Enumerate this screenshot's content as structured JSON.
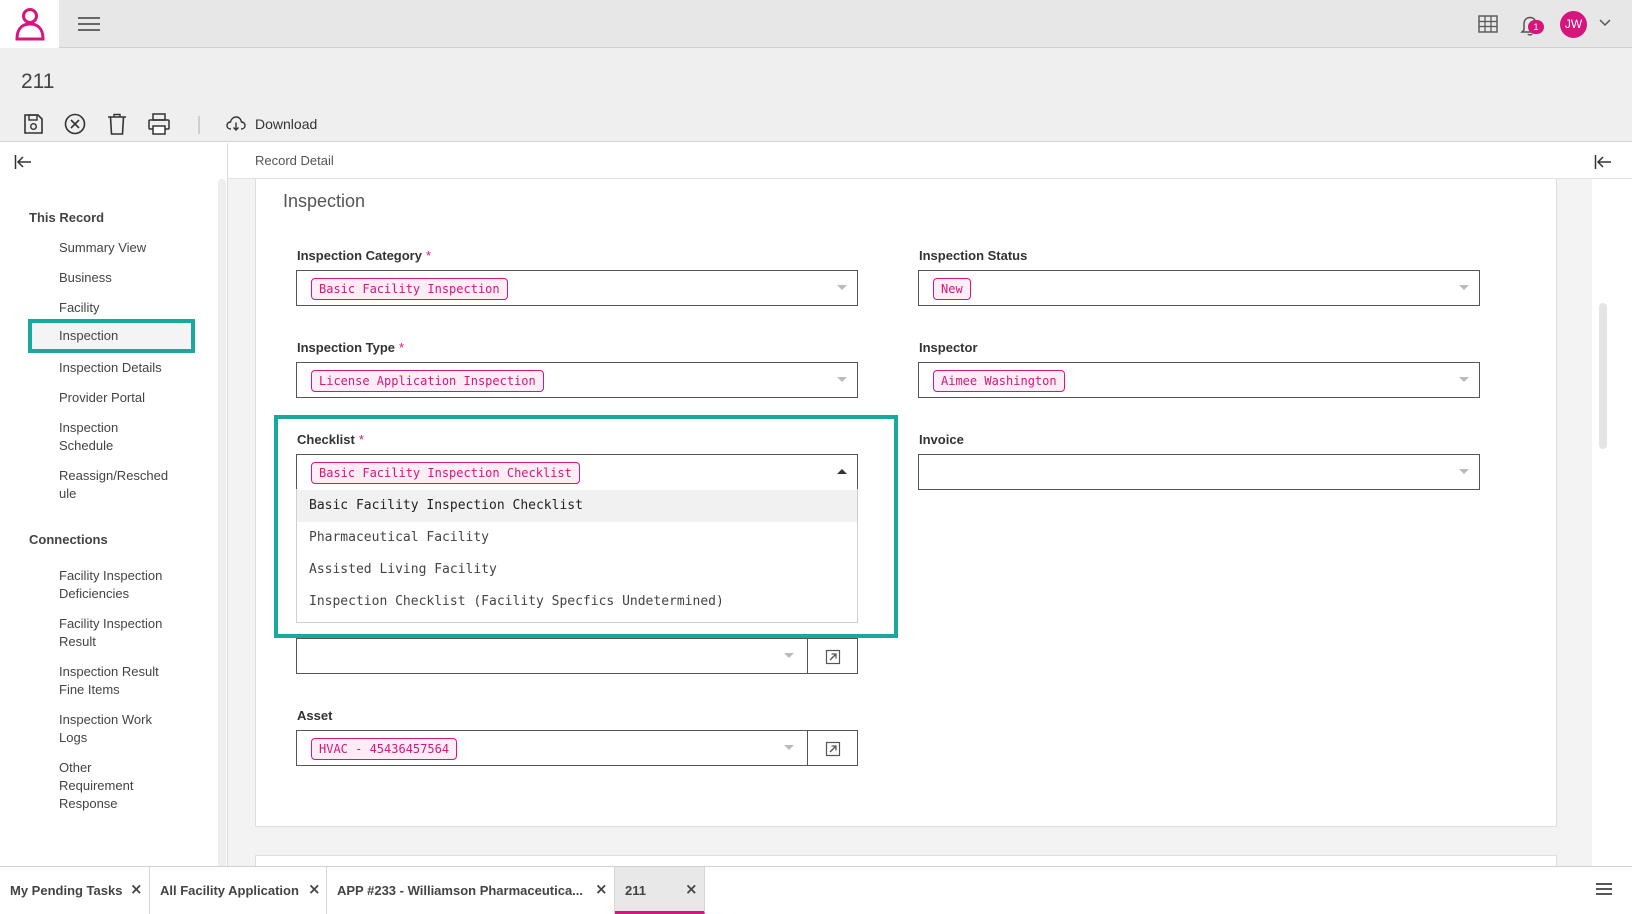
{
  "topbar": {
    "icons": [
      "user-logo-icon",
      "menu-icon",
      "apps-grid-icon",
      "bell-icon",
      "chevron-down-icon"
    ],
    "notification_count": "1",
    "user_initials": "JW"
  },
  "header": {
    "title": "211",
    "toolbar": {
      "icons": [
        "save-icon",
        "cancel-icon",
        "trash-icon",
        "print-icon",
        "cloud-download-icon"
      ],
      "download_label": "Download"
    }
  },
  "sidebar": {
    "sections": [
      {
        "heading": "This Record",
        "items": [
          "Summary View",
          "Business",
          "Facility",
          "Inspection",
          "Inspection Details",
          "Provider Portal",
          "Inspection Schedule",
          "Reassign/Resched ule"
        ]
      },
      {
        "heading": "Connections",
        "items": [
          "Facility Inspection Deficiencies",
          "Facility Inspection Result",
          "Inspection Result Fine Items",
          "Inspection Work Logs",
          "Other Requirement Response"
        ]
      }
    ],
    "active_item": "Inspection"
  },
  "breadcrumb": "Record Detail",
  "form": {
    "section_title": "Inspection",
    "fields": {
      "inspection_category": {
        "label": "Inspection Category",
        "required": "*",
        "value": "Basic Facility Inspection"
      },
      "inspection_status": {
        "label": "Inspection Status",
        "value": "New"
      },
      "inspection_type": {
        "label": "Inspection Type",
        "required": "*",
        "value": "License Application Inspection"
      },
      "inspector": {
        "label": "Inspector",
        "value": "Aimee Washington"
      },
      "checklist": {
        "label": "Checklist",
        "required": "*",
        "value": "Basic Facility Inspection Checklist",
        "options": [
          "Basic Facility Inspection Checklist",
          "Pharmaceutical Facility",
          "Assisted Living Facility",
          "Inspection Checklist (Facility Specfics Undetermined)"
        ]
      },
      "invoice": {
        "label": "Invoice",
        "value": ""
      },
      "hidden_lookup": {
        "value": ""
      },
      "asset": {
        "label": "Asset",
        "value": "HVAC - 45436457564"
      }
    }
  },
  "tabs": [
    {
      "label": "My Pending Tasks",
      "close": "×"
    },
    {
      "label": "All Facility Application",
      "close": "×"
    },
    {
      "label": "APP #233 - Williamson Pharmaceutica...",
      "close": "×"
    },
    {
      "label": "211",
      "close": "×"
    }
  ],
  "colors": {
    "accent": "#d6157d",
    "highlight": "#1aa89a"
  }
}
